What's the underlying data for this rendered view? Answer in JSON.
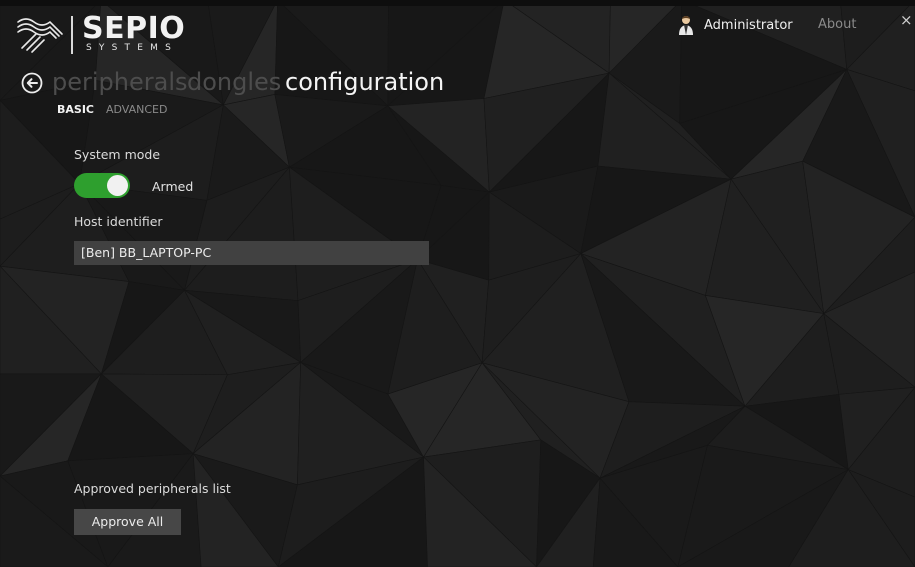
{
  "brand": {
    "name": "SEPIO",
    "tagline": "SYSTEMS",
    "logo_icon": "sepio-wave-icon"
  },
  "header": {
    "user_icon": "user-avatar-icon",
    "user_name": "Administrator",
    "about_label": "About",
    "close_label": "×"
  },
  "nav": {
    "back_icon": "arrow-left-circle-icon",
    "pivots": [
      {
        "label": "peripherals",
        "active": false
      },
      {
        "label": "dongles",
        "active": false
      },
      {
        "label": "configuration",
        "active": true
      }
    ],
    "subtabs": [
      {
        "label": "BASIC",
        "active": true
      },
      {
        "label": "ADVANCED",
        "active": false
      }
    ]
  },
  "form": {
    "system_mode": {
      "label": "System mode",
      "state": "Armed",
      "on": true
    },
    "host_identifier": {
      "label": "Host identifier",
      "value": "[Ben] BB_LAPTOP-PC"
    },
    "approved_list": {
      "label": "Approved peripherals list",
      "button": "Approve All"
    }
  },
  "colors": {
    "background": "#1b1b1b",
    "toggle_on": "#2e9f2e",
    "inactive_text": "#4d4d4d",
    "field_bg": "#414141",
    "button_bg": "#474747"
  }
}
